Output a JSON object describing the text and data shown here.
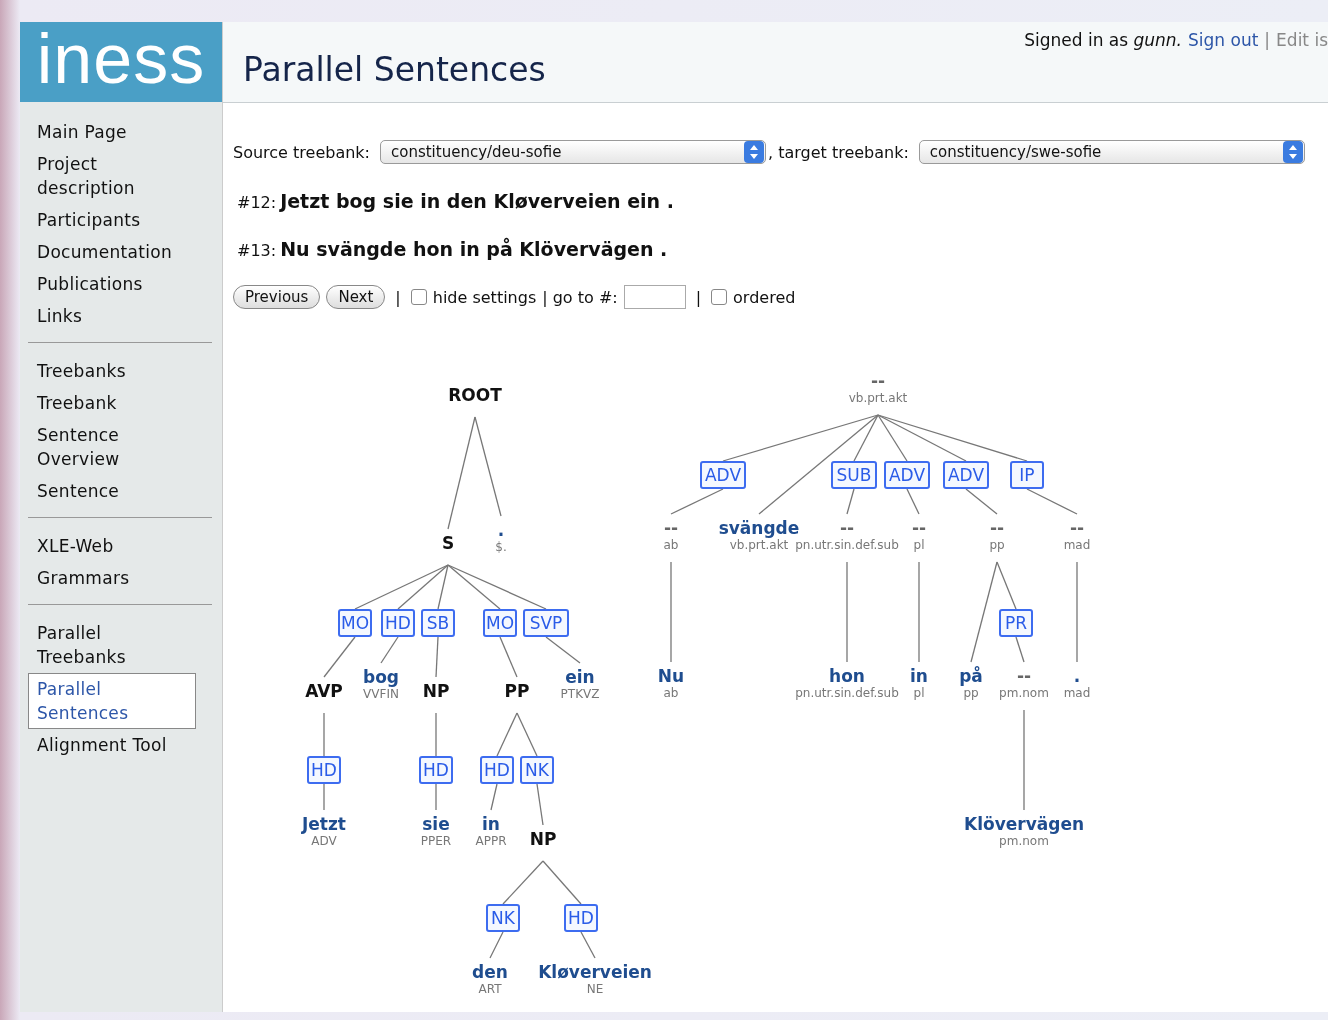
{
  "logo": "iness",
  "header": {
    "title": "Parallel Sentences",
    "user_prefix": "Signed in as",
    "user": "gunn.",
    "links": [
      {
        "label": "Sign out",
        "kind": "link"
      },
      {
        "label": "Edit is",
        "kind": "muted"
      }
    ],
    "separator": "|"
  },
  "sidebar": {
    "groups": [
      [
        {
          "label": "Main Page",
          "selected": false
        },
        {
          "label": "Project description",
          "selected": false
        },
        {
          "label": "Participants",
          "selected": false
        },
        {
          "label": "Documentation",
          "selected": false
        },
        {
          "label": "Publications",
          "selected": false
        },
        {
          "label": "Links",
          "selected": false
        }
      ],
      [
        {
          "label": "Treebanks",
          "selected": false
        },
        {
          "label": "Treebank",
          "selected": false
        },
        {
          "label": "Sentence Overview",
          "selected": false
        },
        {
          "label": "Sentence",
          "selected": false
        }
      ],
      [
        {
          "label": "XLE-Web",
          "selected": false
        },
        {
          "label": "Grammars",
          "selected": false
        }
      ],
      [
        {
          "label": "Parallel Treebanks",
          "selected": false
        },
        {
          "label": "Parallel Sentences",
          "selected": true
        },
        {
          "label": "Alignment Tool",
          "selected": false
        }
      ]
    ]
  },
  "source": {
    "label": "Source treebank:",
    "value": "constituency/deu-sofie"
  },
  "target": {
    "label": ", target treebank:",
    "value": "constituency/swe-sofie"
  },
  "sentences": [
    {
      "number": "#12:",
      "text": "Jetzt bog sie in den Kløverveien ein ."
    },
    {
      "number": "#13:",
      "text": "Nu svängde hon in på Klövervägen ."
    }
  ],
  "controls": {
    "buttons": [
      "Previous",
      "Next"
    ],
    "separator": "|",
    "hide_settings": {
      "label": "hide settings",
      "checked": false
    },
    "goto_label": "| go to #:",
    "separator_2": "|",
    "ordered": {
      "label": "ordered",
      "checked": false
    }
  },
  "trees": [
    {
      "label": "ROOT",
      "kind": "phrase",
      "children": [
        {
          "label": "S",
          "kind": "phrase",
          "children": [
            {
              "label": "AVP",
              "kind": "phrase",
              "edge": "MO",
              "children": [
                {
                  "label": "Jetzt",
                  "tag": "ADV",
                  "kind": "word",
                  "edge": "HD"
                }
              ]
            },
            {
              "label": "bog",
              "tag": "VVFIN",
              "kind": "word",
              "edge": "HD"
            },
            {
              "label": "NP",
              "kind": "phrase",
              "edge": "SB",
              "children": [
                {
                  "label": "sie",
                  "tag": "PPER",
                  "kind": "word",
                  "edge": "HD"
                }
              ]
            },
            {
              "label": "PP",
              "kind": "phrase",
              "edge": "MO",
              "children": [
                {
                  "label": "in",
                  "tag": "APPR",
                  "kind": "word",
                  "edge": "HD"
                },
                {
                  "label": "NP",
                  "kind": "phrase",
                  "edge": "NK",
                  "children": [
                    {
                      "label": "den",
                      "tag": "ART",
                      "kind": "word",
                      "edge": "NK"
                    },
                    {
                      "label": "Kløverveien",
                      "tag": "NE",
                      "kind": "word",
                      "edge": "HD"
                    }
                  ]
                }
              ]
            },
            {
              "label": "ein",
              "tag": "PTKVZ",
              "kind": "word",
              "edge": "SVP"
            }
          ]
        },
        {
          "label": ".",
          "tag": "$.",
          "kind": "word"
        }
      ]
    },
    {
      "label": "--",
      "tag": "vb.prt.akt",
      "kind": "empty",
      "children": [
        {
          "label": "--",
          "tag": "ab",
          "kind": "empty",
          "edge": "ADV",
          "children": [
            {
              "label": "Nu",
              "tag": "ab",
              "kind": "word"
            }
          ]
        },
        {
          "label": "svängde",
          "tag": "vb.prt.akt",
          "kind": "word"
        },
        {
          "label": "--",
          "tag": "pn.utr.sin.def.sub",
          "kind": "empty",
          "edge": "SUB",
          "children": [
            {
              "label": "hon",
              "tag": "pn.utr.sin.def.sub",
              "kind": "word"
            }
          ]
        },
        {
          "label": "--",
          "tag": "pl",
          "kind": "empty",
          "edge": "ADV",
          "children": [
            {
              "label": "in",
              "tag": "pl",
              "kind": "word"
            }
          ]
        },
        {
          "label": "--",
          "tag": "pp",
          "kind": "empty",
          "edge": "ADV",
          "children": [
            {
              "label": "på",
              "tag": "pp",
              "kind": "word"
            },
            {
              "label": "--",
              "tag": "pm.nom",
              "kind": "empty",
              "edge": "PR",
              "children": [
                {
                  "label": "Klövervägen",
                  "tag": "pm.nom",
                  "kind": "word"
                }
              ]
            }
          ]
        },
        {
          "label": "--",
          "tag": "mad",
          "kind": "empty",
          "edge": "IP",
          "children": [
            {
              "label": ".",
              "tag": "mad",
              "kind": "word"
            }
          ]
        }
      ]
    }
  ]
}
